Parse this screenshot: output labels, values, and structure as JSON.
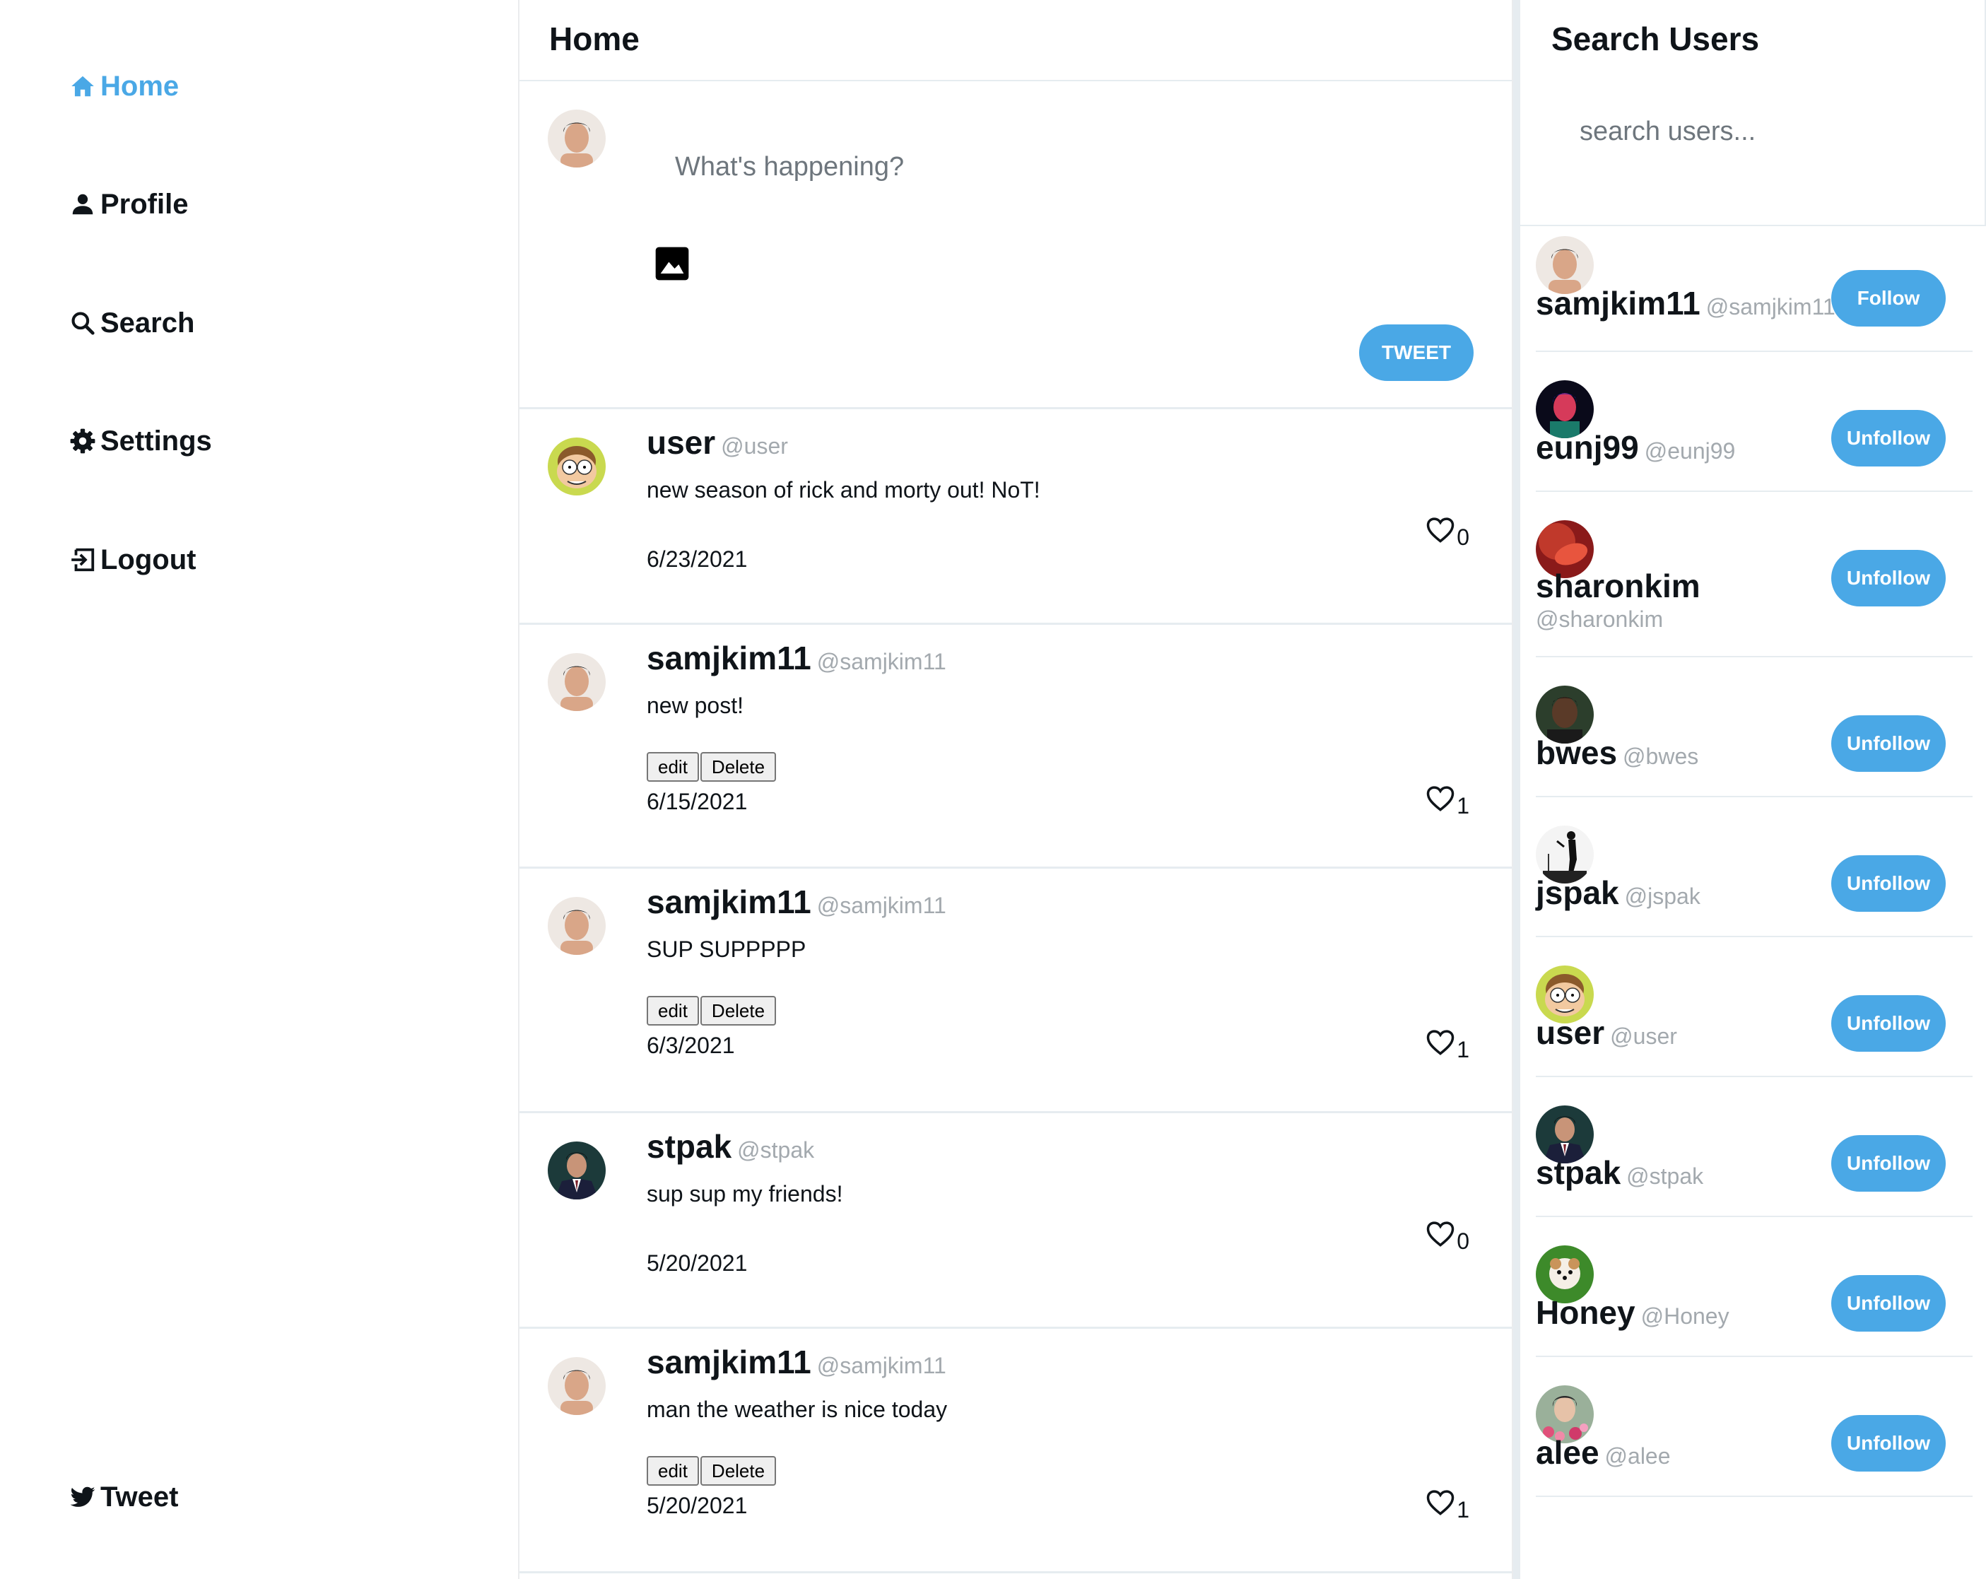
{
  "sidebar": {
    "items": [
      {
        "label": "Home",
        "icon": "home-icon",
        "active": true
      },
      {
        "label": "Profile",
        "icon": "person-icon",
        "active": false
      },
      {
        "label": "Search",
        "icon": "search-icon",
        "active": false
      },
      {
        "label": "Settings",
        "icon": "gear-icon",
        "active": false
      },
      {
        "label": "Logout",
        "icon": "logout-icon",
        "active": false
      }
    ],
    "tweet_label": "Tweet",
    "accent_color": "#4aa8e6"
  },
  "main": {
    "title": "Home",
    "composer": {
      "placeholder": "What's happening?",
      "tweet_button": "TWEET"
    },
    "tweets": [
      {
        "name": "user",
        "handle": "@user",
        "text": "new season of rick and morty out! NoT!",
        "date": "6/23/2021",
        "likes": "0",
        "own": false,
        "avatar": "cartoon"
      },
      {
        "name": "samjkim11",
        "handle": "@samjkim11",
        "text": "new post!",
        "date": "6/15/2021",
        "likes": "1",
        "own": true,
        "avatar": "face"
      },
      {
        "name": "samjkim11",
        "handle": "@samjkim11",
        "text": "SUP SUPPPPP",
        "date": "6/3/2021",
        "likes": "1",
        "own": true,
        "avatar": "face"
      },
      {
        "name": "stpak",
        "handle": "@stpak",
        "text": "sup sup my friends!",
        "date": "5/20/2021",
        "likes": "0",
        "own": false,
        "avatar": "suit"
      },
      {
        "name": "samjkim11",
        "handle": "@samjkim11",
        "text": "man the weather is nice today",
        "date": "5/20/2021",
        "likes": "1",
        "own": true,
        "avatar": "face"
      }
    ],
    "edit_label": "edit",
    "delete_label": "Delete"
  },
  "search_panel": {
    "title": "Search Users",
    "placeholder": "search users...",
    "users": [
      {
        "name": "samjkim11",
        "handle": "@samjkim11",
        "button": "Follow",
        "avatar": "face"
      },
      {
        "name": "eunj99",
        "handle": "@eunj99",
        "button": "Unfollow",
        "avatar": "neon"
      },
      {
        "name": "sharonkim",
        "handle": "@sharonkim",
        "button": "Unfollow",
        "avatar": "red"
      },
      {
        "name": "bwes",
        "handle": "@bwes",
        "button": "Unfollow",
        "avatar": "dark"
      },
      {
        "name": "jspak",
        "handle": "@jspak",
        "button": "Unfollow",
        "avatar": "silhouette"
      },
      {
        "name": "user",
        "handle": "@user",
        "button": "Unfollow",
        "avatar": "cartoon"
      },
      {
        "name": "stpak",
        "handle": "@stpak",
        "button": "Unfollow",
        "avatar": "suit"
      },
      {
        "name": "Honey",
        "handle": "@Honey",
        "button": "Unfollow",
        "avatar": "dog"
      },
      {
        "name": "alee",
        "handle": "@alee",
        "button": "Unfollow",
        "avatar": "flowers"
      }
    ]
  }
}
